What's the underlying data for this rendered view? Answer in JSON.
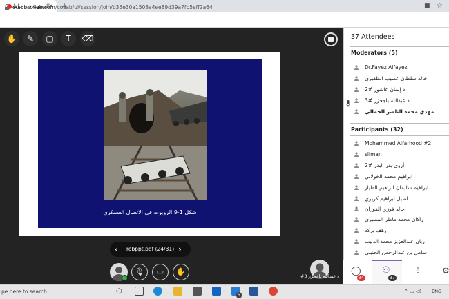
{
  "browser": {
    "tab_title": "الروبوت في حياتنا",
    "tab_close": "×",
    "new_tab": "+",
    "url_host": "eu.bbcollab.com",
    "url_path": "/collab/ui/session/join/b35e30a1508a4ee89d39a7fb5eff2a64"
  },
  "stage": {
    "slide_caption": "شكل 1-9 الروبوت في الاتصال العسكري",
    "pager_label": "robppt.pdf  (24/31)",
    "prev": "‹",
    "next": "›",
    "speaker_name": "د عبدالله باجحزر 3#"
  },
  "tools": [
    "pointer-icon",
    "pen-icon",
    "shape-icon",
    "text-icon",
    "eraser-icon"
  ],
  "panel": {
    "title": "37 Attendees",
    "moderators_title": "Moderators (5)",
    "moderators": [
      "Dr.Fayez Alfayez",
      "خالد سلطان عصيب الظفيري",
      "د إيمان عاشور #2",
      "د عبدالله باجحزر #3",
      "مهدي محمد الناصر الجمالي"
    ],
    "participants_title": "Participants (32)",
    "participants": [
      "Mohammed Alfarhood #2",
      "sliman",
      "أروى بدر البدر #2",
      "ابراهيم محمد الخولاني",
      "ابراهيم سليمان ابراهيم الطيار",
      "اصيل ابراهيم كريري",
      "خالد فوزي الفوزان",
      "راكان محمد ماطر المطيري",
      "رهف بركه",
      "ريان عبدالعزيز محمد الذبيب",
      "سامي بن عبدالرحمن الحنيني"
    ],
    "chat_badge": "34",
    "attendees_badge": "37"
  },
  "taskbar": {
    "search": "pe here to search",
    "lang": "ENG",
    "badge": "5"
  },
  "colors": {
    "accent": "#8c5bb5",
    "slide_bg": "#0f1270",
    "status_green": "#2bb24c",
    "badge_red": "#e0373e"
  }
}
